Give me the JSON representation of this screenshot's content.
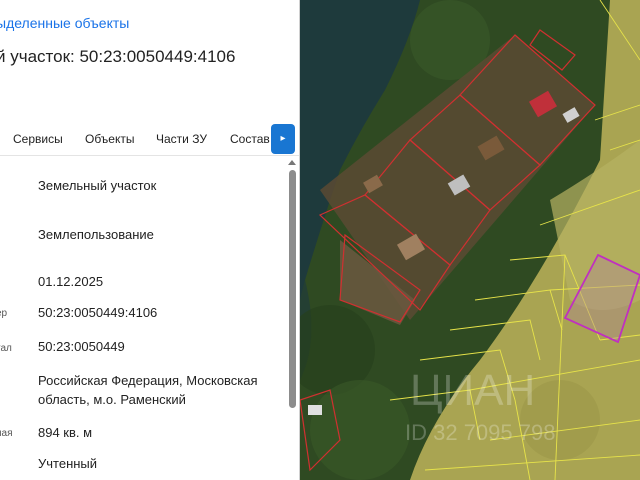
{
  "panel": {
    "link_text": "ыделенные объекты",
    "title": "й участок: 50:23:0050449:4106",
    "tabs": [
      "Сервисы",
      "Объекты",
      "Части ЗУ",
      "Состав"
    ],
    "tab_next_icon": "chevron-right-icon",
    "rows": [
      {
        "label": "",
        "value": "Земельный участок"
      },
      {
        "label": "",
        "value": "Землепользование"
      },
      {
        "label": "",
        "value": "01.12.2025"
      },
      {
        "label": "ер",
        "value": "50:23:0050449:4106"
      },
      {
        "label": "тал",
        "value": "50:23:0050449"
      },
      {
        "label": "",
        "value": "Российская Федерация, Московская область, м.о. Раменский"
      },
      {
        "label": "ная",
        "value": "894 кв. м"
      },
      {
        "label": "",
        "value": "Учтенный"
      }
    ]
  },
  "map": {
    "watermark_line1": "ЦИАН",
    "watermark_line2": "ID 32 7095 798",
    "colors": {
      "water": "#1e3a3c",
      "forest": "#2f4a22",
      "field": "#a9a452",
      "parcel_red": "#d03030",
      "parcel_yellow": "#e7e34a",
      "selected": "#c030c0"
    }
  }
}
